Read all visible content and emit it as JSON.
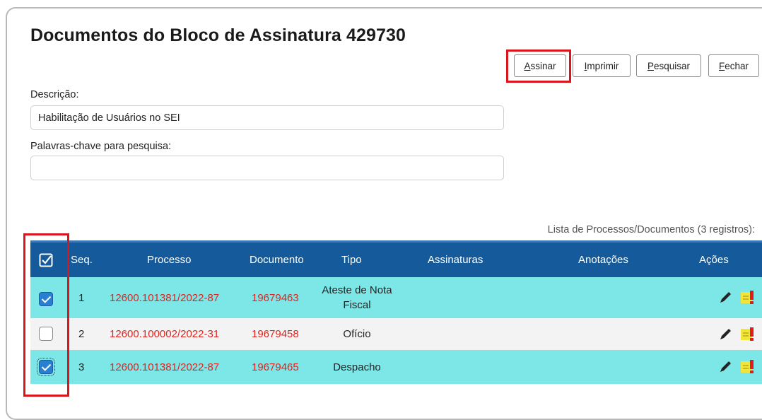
{
  "page": {
    "title": "Documentos do Bloco de Assinatura 429730"
  },
  "toolbar": {
    "buttons": [
      {
        "underline": "A",
        "rest": "ssinar",
        "highlighted": true
      },
      {
        "underline": "I",
        "rest": "mprimir",
        "highlighted": false
      },
      {
        "underline": "P",
        "rest": "esquisar",
        "highlighted": false
      },
      {
        "underline": "F",
        "rest": "echar",
        "highlighted": false
      }
    ]
  },
  "form": {
    "description_label": "Descrição:",
    "description_value": "Habilitação de Usuários no SEI",
    "keywords_label": "Palavras-chave para pesquisa:",
    "keywords_value": ""
  },
  "table": {
    "caption": "Lista de Processos/Documentos (3 registros):",
    "columns": [
      "Seq.",
      "Processo",
      "Documento",
      "Tipo",
      "Assinaturas",
      "Anotações",
      "Ações"
    ],
    "rows": [
      {
        "selected": true,
        "seq": "1",
        "processo": "12600.101381/2022-87",
        "documento": "19679463",
        "tipo": "Ateste de Nota Fiscal",
        "assinaturas": "",
        "anotacoes": ""
      },
      {
        "selected": false,
        "seq": "2",
        "processo": "12600.100002/2022-31",
        "documento": "19679458",
        "tipo": "Ofício",
        "assinaturas": "",
        "anotacoes": ""
      },
      {
        "selected": true,
        "seq": "3",
        "processo": "12600.101381/2022-87",
        "documento": "19679465",
        "tipo": "Despacho",
        "assinaturas": "",
        "anotacoes": ""
      }
    ]
  },
  "icons": {
    "select_all": "checkbox-all-icon",
    "sign": "pen-icon",
    "annotation": "note-alert-icon"
  },
  "colors": {
    "header_bg": "#155a9a",
    "selected_row": "#7de6e6",
    "link_red": "#e1231f",
    "highlight": "#d8161c"
  }
}
